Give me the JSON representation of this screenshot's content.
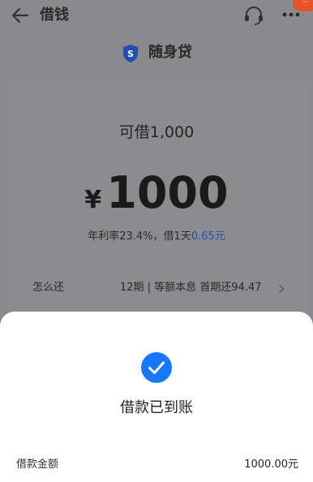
{
  "header": {
    "title": "借钱",
    "back_icon": "arrow-left-icon",
    "service_icon": "headset-icon",
    "more_icon": "more-dots-icon",
    "badge_text": "···"
  },
  "brand": {
    "icon": "shield-s-icon",
    "icon_letter": "S",
    "name": "随身贷",
    "color": "#1f4fb0"
  },
  "loan": {
    "available_text": "可借1,000",
    "currency_symbol": "¥",
    "amount": "1000",
    "rate_text": "年利率23.4%，借1天",
    "daily_cost": "0.65元",
    "repay_label": "怎么还",
    "repay_plan": "12期 | 等额本息 首期还94.47"
  },
  "result_sheet": {
    "status_icon": "check-circle-icon",
    "status_color": "#1677ff",
    "title": "借款已到账",
    "detail_label": "借款金额",
    "detail_value": "1000.00元"
  }
}
